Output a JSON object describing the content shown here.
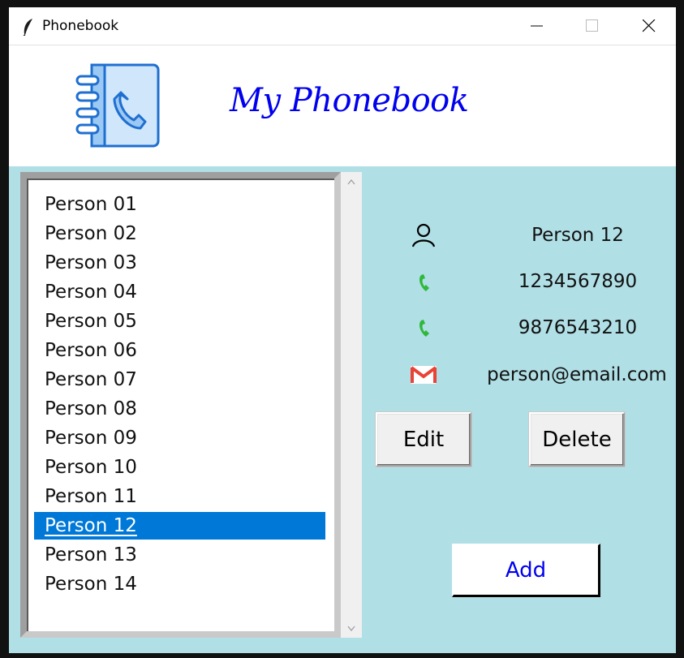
{
  "window": {
    "title": "Phonebook",
    "controls": {
      "minimize_icon": "minimize-icon",
      "maximize_icon": "maximize-icon",
      "close_icon": "close-icon"
    }
  },
  "header": {
    "logo_icon": "phonebook-logo-icon",
    "title": "My Phonebook",
    "title_color": "#0000ee"
  },
  "contacts": {
    "items": [
      "Person 01",
      "Person 02",
      "Person 03",
      "Person 04",
      "Person 05",
      "Person 06",
      "Person 07",
      "Person 08",
      "Person 09",
      "Person 10",
      "Person 11",
      "Person 12",
      "Person 13",
      "Person 14"
    ],
    "selected": "Person 12",
    "selection_color": "#0078d7"
  },
  "details": {
    "name": "Person 12",
    "phone1": "1234567890",
    "phone2": "9876543210",
    "email": "person@email.com",
    "icons": {
      "name": "person-icon",
      "phone": "phone-icon",
      "email": "gmail-icon"
    }
  },
  "actions": {
    "edit_label": "Edit",
    "delete_label": "Delete",
    "add_label": "Add"
  },
  "colors": {
    "panel_bg": "#b0dfe5",
    "phone_green": "#2fb83a",
    "gmail_red": "#ea4335"
  }
}
